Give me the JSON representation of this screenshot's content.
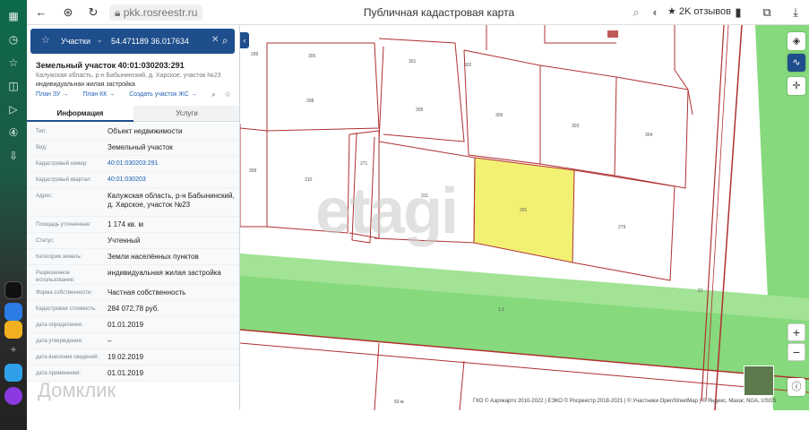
{
  "browser": {
    "url": "pkk.rosreestr.ru",
    "page_title": "Публичная кадастровая карта",
    "reviews": "2K отзывов"
  },
  "search": {
    "type_label": "Участки",
    "value": "54.471189 36.017634"
  },
  "object": {
    "title": "Земельный участок 40:01:030203:291",
    "address_short": "Калужская область, р-н Бабынинский, д. Харское, участок №23",
    "usage_short": "индивидуальная жилая застройка",
    "links": [
      "План ЗУ →",
      "План КК →",
      "Создать участок ЖС →"
    ]
  },
  "tabs": [
    "Информация",
    "Услуги"
  ],
  "info_rows": [
    {
      "key": "Тип:",
      "value": "Объект недвижимости"
    },
    {
      "key": "Вид:",
      "value": "Земельный участок"
    },
    {
      "key": "Кадастровый номер:",
      "value": "40:01:030203:291",
      "link": true
    },
    {
      "key": "Кадастровый квартал:",
      "value": "40:01:030203",
      "link": true
    },
    {
      "key": "Адрес:",
      "value": "Калужская область, р-н Бабынинский, д. Харское, участок №23"
    },
    {
      "key": "Площадь уточненная:",
      "value": "1 174 кв. м"
    },
    {
      "key": "Статус:",
      "value": "Учтенный"
    },
    {
      "key": "Категория земель:",
      "value": "Земли населённых пунктов"
    },
    {
      "key": "Разрешенное использование:",
      "value": "индивидуальная жилая застройка"
    },
    {
      "key": "Форма собственности:",
      "value": "Частная собственность"
    },
    {
      "key": "Кадастровая стоимость:",
      "value": "284 072,78 руб."
    },
    {
      "key": "дата определения:",
      "value": "01.01.2019"
    },
    {
      "key": "дата утверждения:",
      "value": "–"
    },
    {
      "key": "дата внесения сведений:",
      "value": "19.02.2019"
    },
    {
      "key": "дата применения:",
      "value": "01.01.2019"
    }
  ],
  "map": {
    "labels": [
      "299",
      "300",
      "301",
      "302",
      "303",
      "304",
      "305",
      "306",
      "308",
      "309",
      "310",
      "311",
      "271",
      "279",
      "21",
      "291",
      "1.1"
    ],
    "attribution": "ГКО © Аэрокарто 2010-2022 | ЕЭКО © Росреестр 2018-2021 | © Участники OpenStreetMap | © Яндекс, Maxar, NGA, USGS",
    "scale": "50 м",
    "colors": {
      "selected": "#f3f173",
      "road": "#80d878",
      "boundary": "#b03030"
    }
  },
  "controls": {
    "zoom_in": "+",
    "zoom_out": "−"
  },
  "watermarks": {
    "etagi": "etagi",
    "domclick": "Домклик"
  }
}
